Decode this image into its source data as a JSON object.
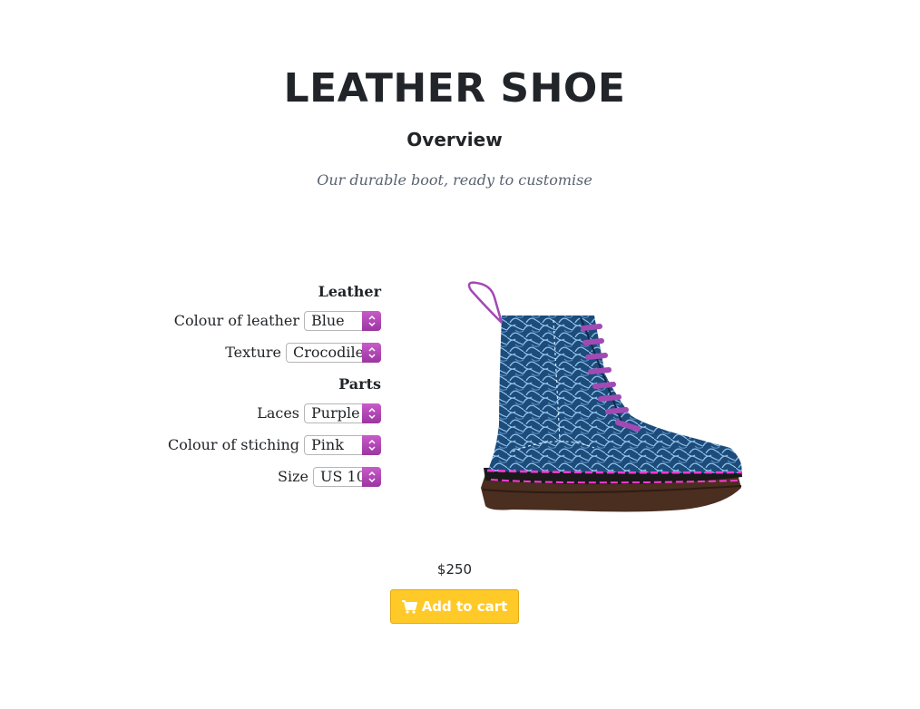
{
  "product": {
    "title": "LEATHER SHOE",
    "subtitle": "Overview",
    "tagline": "Our durable boot, ready to customise"
  },
  "options": {
    "leather_heading": "Leather",
    "parts_heading": "Parts",
    "colour_of_leather": {
      "label": "Colour of leather",
      "value": "Blue"
    },
    "texture": {
      "label": "Texture",
      "value": "Crocodile"
    },
    "laces": {
      "label": "Laces",
      "value": "Purple"
    },
    "colour_of_stitching": {
      "label": "Colour of stiching",
      "value": "Pink"
    },
    "size": {
      "label": "Size",
      "value": "US 10"
    }
  },
  "price": "$250",
  "cart": {
    "label": "Add to cart",
    "icon": "cart-icon",
    "color": "#ffc928"
  },
  "colors": {
    "select_accent": "#b24bb6",
    "leather": "#1e4a78",
    "laces": "#a24ab4",
    "stitching": "#ff3ad8",
    "sole": "#4a2e20"
  }
}
